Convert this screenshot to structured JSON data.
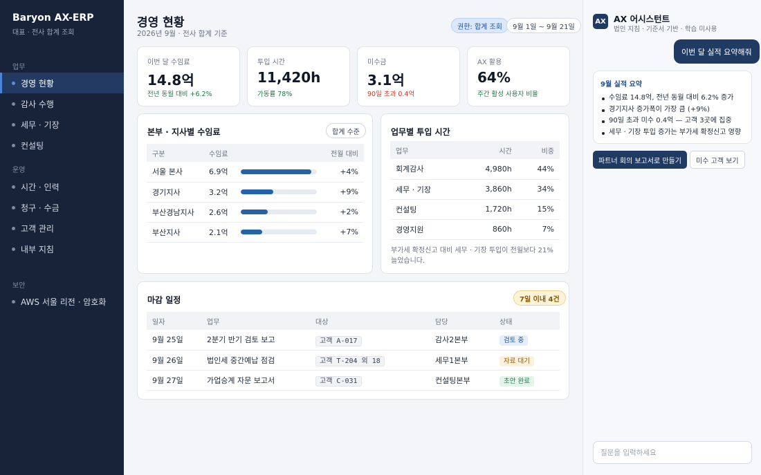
{
  "app": {
    "title": "Baryon AX-ERP",
    "subtitle": "대표 · 전사 합계 조회"
  },
  "sidebar": {
    "sections": [
      {
        "label": "업무"
      },
      {
        "label": "운영"
      },
      {
        "label": "보안"
      }
    ],
    "items": [
      {
        "label": "경영 현황",
        "active": true
      },
      {
        "label": "감사 수행"
      },
      {
        "label": "세무 · 기장"
      },
      {
        "label": "컨설팅"
      },
      {
        "label": "시간 · 인력"
      },
      {
        "label": "청구 · 수금"
      },
      {
        "label": "고객 관리"
      },
      {
        "label": "내부 지침"
      },
      {
        "label": "AWS 서울 리전 · 암호화"
      }
    ]
  },
  "header": {
    "title": "경영 현황",
    "subtitle": "2026년 9월 · 전사 합계 기준",
    "permission_badge": "권한: 합계 조회",
    "range_badge": "9월 1일 ~ 9월 21일"
  },
  "kpis": [
    {
      "label": "이번 달 수임료",
      "value": "14.8억",
      "note": "전년 동월 대비 +6.2%",
      "tone": "green"
    },
    {
      "label": "투입 시간",
      "value": "11,420h",
      "note": "가동률 78%",
      "tone": "green"
    },
    {
      "label": "미수금",
      "value": "3.1억",
      "note": "90일 초과 0.4억",
      "tone": "red"
    },
    {
      "label": "AX 활용",
      "value": "64%",
      "note": "주간 활성 사용자 비율",
      "tone": "green"
    }
  ],
  "branch_revenue": {
    "title": "본부 · 지사별 수임료",
    "button": "합계 수준",
    "headers": [
      "구분",
      "수임료",
      "전월 대비"
    ],
    "rows": [
      {
        "name": "서울 본사",
        "amount": "6.9억",
        "progress": 0.93,
        "change": "+4%"
      },
      {
        "name": "경기지사",
        "amount": "3.2억",
        "progress": 0.43,
        "change": "+9%"
      },
      {
        "name": "부산경남지사",
        "amount": "2.6억",
        "progress": 0.35,
        "change": "+2%"
      },
      {
        "name": "부산지사",
        "amount": "2.1억",
        "progress": 0.28,
        "change": "+7%"
      }
    ]
  },
  "hours_by_task": {
    "title": "업무별 투입 시간",
    "headers": [
      "업무",
      "시간",
      "비중"
    ],
    "rows": [
      {
        "task": "회계감사",
        "hours": "4,980h",
        "share": "44%"
      },
      {
        "task": "세무 · 기장",
        "hours": "3,860h",
        "share": "34%"
      },
      {
        "task": "컨설팅",
        "hours": "1,720h",
        "share": "15%"
      },
      {
        "task": "경영지원",
        "hours": "860h",
        "share": "7%"
      }
    ],
    "note": "부가세 확정신고 대비 세무 · 기장 투입이 전월보다 21% 늘었습니다."
  },
  "deadlines": {
    "title": "마감 일정",
    "badge": "7일 이내 4건",
    "headers": [
      "일자",
      "업무",
      "대상",
      "담당",
      "상태"
    ],
    "rows": [
      {
        "date": "9월 25일",
        "task": "2분기 반기 검토 보고",
        "target": "고객 A-017",
        "owner": "감사2본부",
        "status": "검토 중",
        "status_tone": "blue"
      },
      {
        "date": "9월 26일",
        "task": "법인세 중간예납 점검",
        "target": "고객 T-204 외 18",
        "owner": "세무1본부",
        "status": "자료 대기",
        "status_tone": "amber"
      },
      {
        "date": "9월 27일",
        "task": "가업승계 자문 보고서",
        "target": "고객 C-031",
        "owner": "컨설팅본부",
        "status": "초안 완료",
        "status_tone": "green"
      }
    ]
  },
  "assistant": {
    "logo": "AX",
    "title": "AX 어시스턴트",
    "subtitle": "법인 지침 · 기준서 기반 · 학습 미사용",
    "user_message": "이번 달 실적 요약해줘",
    "reply_title": "9월 실적 요약",
    "reply_items": [
      "수임료 14.8억, 전년 동월 대비 6.2% 증가",
      "경기지사 증가폭이 가장 큼 (+9%)",
      "90일 초과 미수 0.4억 — 고객 3곳에 집중",
      "세무 · 기장 투입 증가는 부가세 확정신고 영향"
    ],
    "action_primary": "파트너 회의 보고서로 만들기",
    "action_secondary": "미수 고객 보기",
    "input_placeholder": "질문을 입력하세요"
  },
  "colors": {
    "sidebar_bg": "#172338",
    "accent": "#1f3a63",
    "bar": "#2563a9",
    "positive": "#1f7a4d",
    "negative": "#c0392b"
  }
}
